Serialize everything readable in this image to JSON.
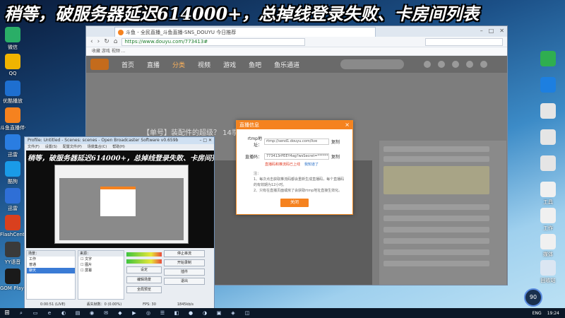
{
  "banner": "稍等，破服务器延迟614000+，总掉线登录失败、卡房间列表",
  "desktop_icons_left": [
    {
      "label": "微信",
      "color": "#2aae67",
      "icon": "chat-icon"
    },
    {
      "label": "QQ",
      "color": "#f0b400",
      "icon": "penguin-icon"
    },
    {
      "label": "优酷播放",
      "color": "#1e6fd0",
      "icon": "play-icon"
    },
    {
      "label": "斗鱼直播伴侣",
      "color": "#f5821f",
      "icon": "fish-icon"
    },
    {
      "label": "迅雷",
      "color": "#2a7de1",
      "icon": "bolt-icon"
    },
    {
      "label": "酷狗",
      "color": "#1a9be8",
      "icon": "music-icon"
    },
    {
      "label": "迅雷",
      "color": "#2f6fd6",
      "icon": "bird-icon"
    },
    {
      "label": "FlashCenter",
      "color": "#d9401e",
      "icon": "flash-icon"
    },
    {
      "label": "YY语音",
      "color": "#3a3a3a",
      "icon": "voice-icon"
    },
    {
      "label": "GOM Player",
      "color": "#1a1a1a",
      "icon": "gom-icon"
    }
  ],
  "desktop_icons_right": [
    {
      "label": "",
      "color": "#2fae50",
      "icon": "leaf-icon"
    },
    {
      "label": "",
      "color": "#1d7fe0",
      "icon": "globe-icon"
    },
    {
      "label": "",
      "color": "#e5e5e5",
      "icon": "chrome-icon"
    },
    {
      "label": "",
      "color": "#e5e5e5",
      "icon": "chrome-icon"
    },
    {
      "label": "",
      "color": "#e5e5e5",
      "icon": "chrome-icon"
    },
    {
      "label": "工具",
      "color": "#f0f0f0",
      "icon": "folder-icon"
    },
    {
      "label": "工作",
      "color": "#f0f0f0",
      "icon": "doc-icon"
    },
    {
      "label": "媒体",
      "color": "#f0f0f0",
      "icon": "doc-icon"
    },
    {
      "label": "回收站",
      "color": "#dbe6f2",
      "icon": "recycle-bin-icon"
    }
  ],
  "browser": {
    "tab_title": "斗鱼 - 全民直播_斗鱼直播-SNS_DOUYU 今日推荐",
    "url": "https://www.douyu.com/773413#",
    "window_controls": [
      "–",
      "□",
      "✕"
    ],
    "bookmarks": "收藏  游戏  视频  ...",
    "site": {
      "nav": [
        "首页",
        "直播",
        "分类",
        "视频",
        "游戏",
        "鱼吧",
        "鱼乐通道"
      ],
      "active_nav": "分类",
      "room_title": "【单号】装配件的超级？ 14季悬赏奖励来临"
    }
  },
  "dialog": {
    "title": "直播信息",
    "close": "×",
    "rtmp_label": "rtmp地址：",
    "rtmp_value": "rtmp://send1.douyu.com/live",
    "code_label": "直播码：",
    "code_value": "773413rPEEY4ag?wsSecret=************",
    "copy_label": "复制",
    "warn_red": "直播码和推流码已上线",
    "warn_blue": "我知道了",
    "note_title": "注：",
    "note_1": "1、每次点击获取推流码都会重新生成直播码，每个直播码的有效期为12小时。",
    "note_2": "2、只有在直播页面或房了会获取rtmp地址直接生效化。",
    "close_button": "关闭"
  },
  "obs": {
    "title": "Profile: Untitled - Scenes: scenes - Open Broadcaster Software v0.659b",
    "window_controls": [
      "–",
      "□",
      "✕"
    ],
    "menu": [
      "文件(F)",
      "设置(S)",
      "配置文件(P)",
      "场景集合(C)",
      "帮助(H)"
    ],
    "mini_banner": "稍等，破服务器延迟614000+，总掉线登录失败、卡房间列表",
    "scenes_header": "场景：",
    "scenes": [
      "工作",
      "普通",
      "聊天"
    ],
    "selected_scene": "聊天",
    "sources_header": "来源：",
    "sources": [
      "文字",
      "图片",
      "屏幕"
    ],
    "buttons": {
      "settings": "设定",
      "stop_stream": "停止串流",
      "edit_scene": "编辑场景",
      "start_record": "开始录制",
      "fullscreen": "全局预览",
      "plugins": "插件",
      "exit": "退出"
    },
    "status": {
      "time": "0:00:51 (LIVE)",
      "dropped": "丢失帧数：0 (0.00%)",
      "fps": "FPS: 30",
      "bitrate": "1845kb/s"
    }
  },
  "taskbar": {
    "start_icon": "windows-start-icon",
    "apps": [
      "⌕",
      "▭",
      "e",
      "◐",
      "▤",
      "◉",
      "✉",
      "◆",
      "▶",
      "◎",
      "☰",
      "◧",
      "●",
      "◑",
      "▣",
      "◈",
      "◫"
    ],
    "lang": "ENG",
    "time": "19:24"
  },
  "speed_widget": "90"
}
